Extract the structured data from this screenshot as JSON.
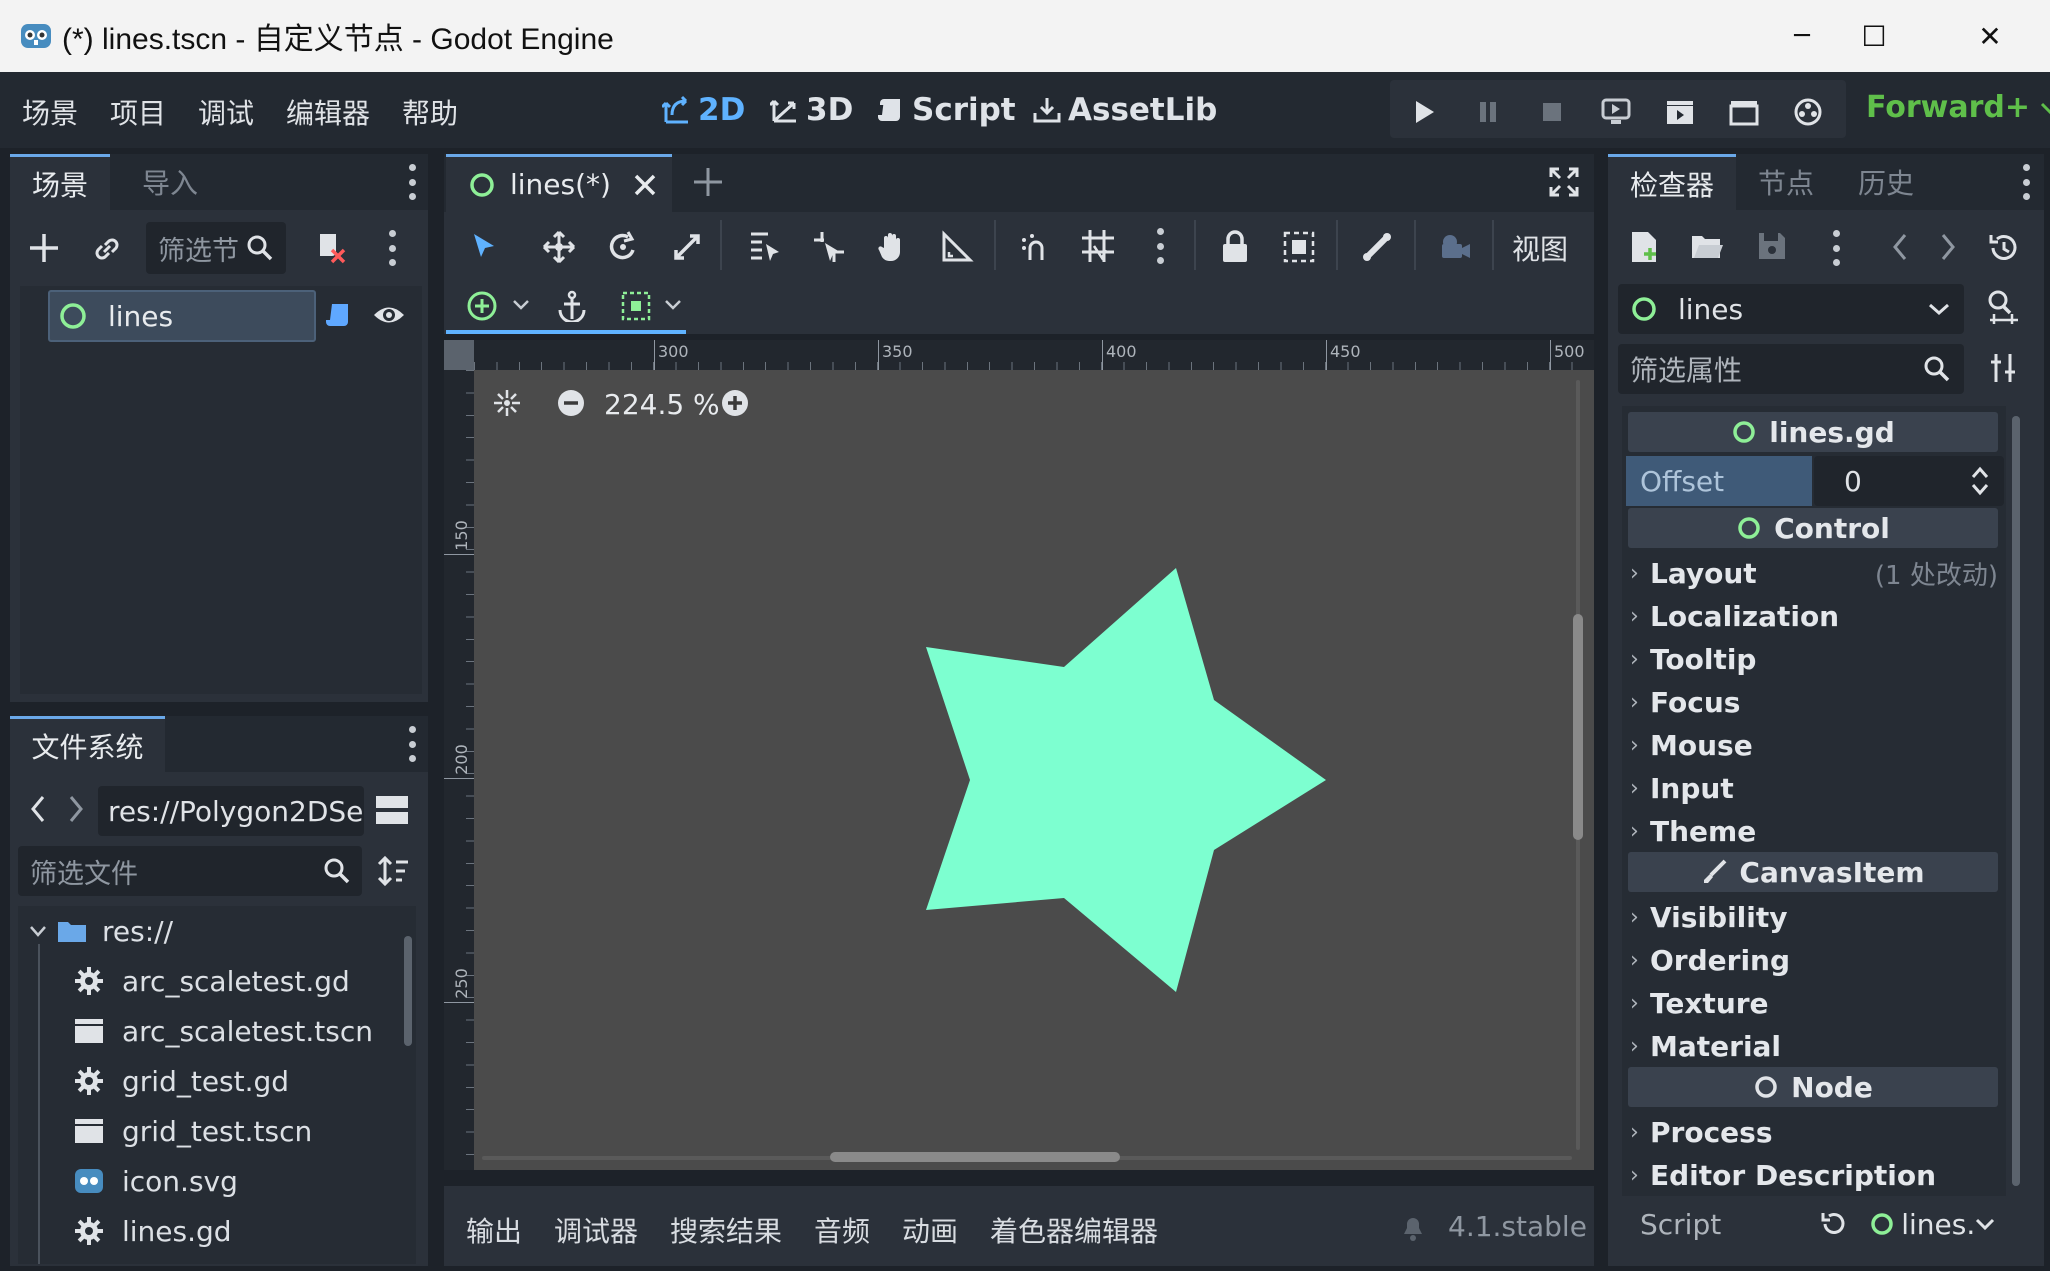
{
  "window": {
    "title": "(*) lines.tscn - 自定义节点 - Godot Engine",
    "minimize_symbol": "─",
    "maximize_symbol": "☐",
    "close_symbol": "✕"
  },
  "menu": [
    "场景",
    "项目",
    "调试",
    "编辑器",
    "帮助"
  ],
  "workspaces": [
    {
      "label": "2D",
      "icon": "2d-icon",
      "active": true
    },
    {
      "label": "3D",
      "icon": "3d-icon",
      "active": false
    },
    {
      "label": "Script",
      "icon": "script-icon",
      "active": false
    },
    {
      "label": "AssetLib",
      "icon": "assetlib-icon",
      "active": false
    }
  ],
  "renderer": "Forward+",
  "scene_dock": {
    "tabs": [
      "场景",
      "导入"
    ],
    "filter_placeholder": "筛选节",
    "root_node": "lines"
  },
  "filesystem_dock": {
    "tab": "文件系统",
    "path": "res://Polygon2DSe",
    "filter_placeholder": "筛选文件",
    "items": [
      {
        "name": "res://",
        "icon": "folder-icon"
      },
      {
        "name": "arc_scaletest.gd",
        "icon": "gear-icon"
      },
      {
        "name": "arc_scaletest.tscn",
        "icon": "clapper-icon"
      },
      {
        "name": "grid_test.gd",
        "icon": "gear-icon"
      },
      {
        "name": "grid_test.tscn",
        "icon": "clapper-icon"
      },
      {
        "name": "icon.svg",
        "icon": "godot-icon"
      },
      {
        "name": "lines.gd",
        "icon": "gear-icon"
      }
    ]
  },
  "editor": {
    "tab_label": "lines(*)",
    "view_menu": "视图",
    "zoom": "224.5 %",
    "ruler_h": [
      "300",
      "350",
      "400",
      "450",
      "500"
    ],
    "ruler_v": [
      "150",
      "200",
      "250"
    ],
    "star_color": "#7dffd0"
  },
  "bottom_panel": {
    "tabs": [
      "输出",
      "调试器",
      "搜索结果",
      "音频",
      "动画",
      "着色器编辑器"
    ],
    "version": "4.1.stable"
  },
  "inspector": {
    "tabs": [
      "检查器",
      "节点",
      "历史"
    ],
    "node_name": "lines",
    "filter_placeholder": "筛选属性",
    "script_section": "lines.gd",
    "offset_label": "Offset",
    "offset_value": "0",
    "control_section": "Control",
    "control_props": [
      "Layout",
      "Localization",
      "Tooltip",
      "Focus",
      "Mouse",
      "Input",
      "Theme"
    ],
    "layout_note": "(1 处改动)",
    "canvasitem_section": "CanvasItem",
    "canvasitem_props": [
      "Visibility",
      "Ordering",
      "Texture",
      "Material"
    ],
    "node_section": "Node",
    "node_props": [
      "Process",
      "Editor Description"
    ],
    "script_label": "Script",
    "script_value": "lines."
  }
}
